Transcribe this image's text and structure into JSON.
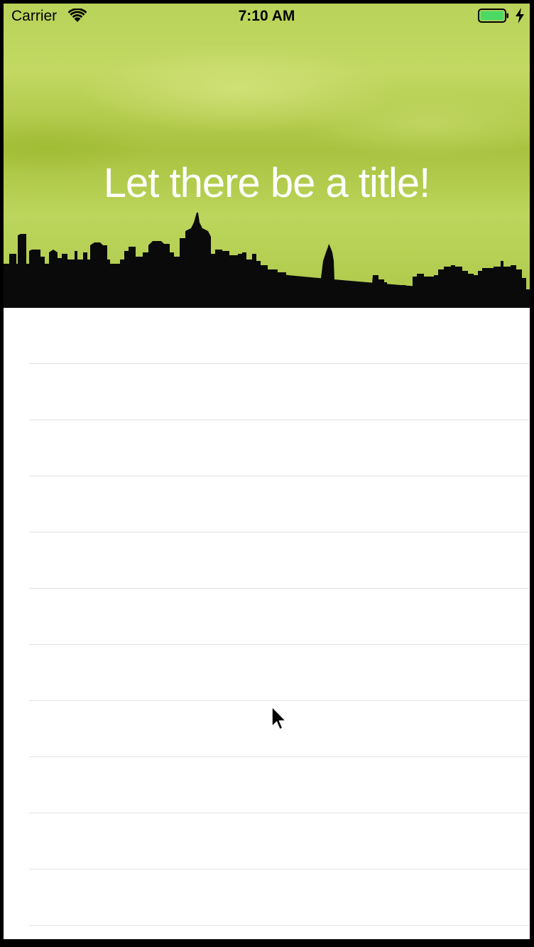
{
  "status_bar": {
    "carrier": "Carrier",
    "time": "7:10 AM",
    "wifi_icon": "wifi-icon",
    "battery_icon": "battery-icon",
    "charging_icon": "charging-bolt-icon",
    "battery_level": 1.0,
    "battery_color": "#4cd964"
  },
  "header": {
    "title": "Let there be a title!",
    "background_color": "#b4cd52",
    "skyline_icon": "city-skyline-silhouette"
  },
  "table": {
    "rows": [
      "",
      "",
      "",
      "",
      "",
      "",
      "",
      "",
      "",
      "",
      ""
    ],
    "separator_color": "#e3e3e6"
  },
  "cursor_icon": "mouse-pointer-icon"
}
